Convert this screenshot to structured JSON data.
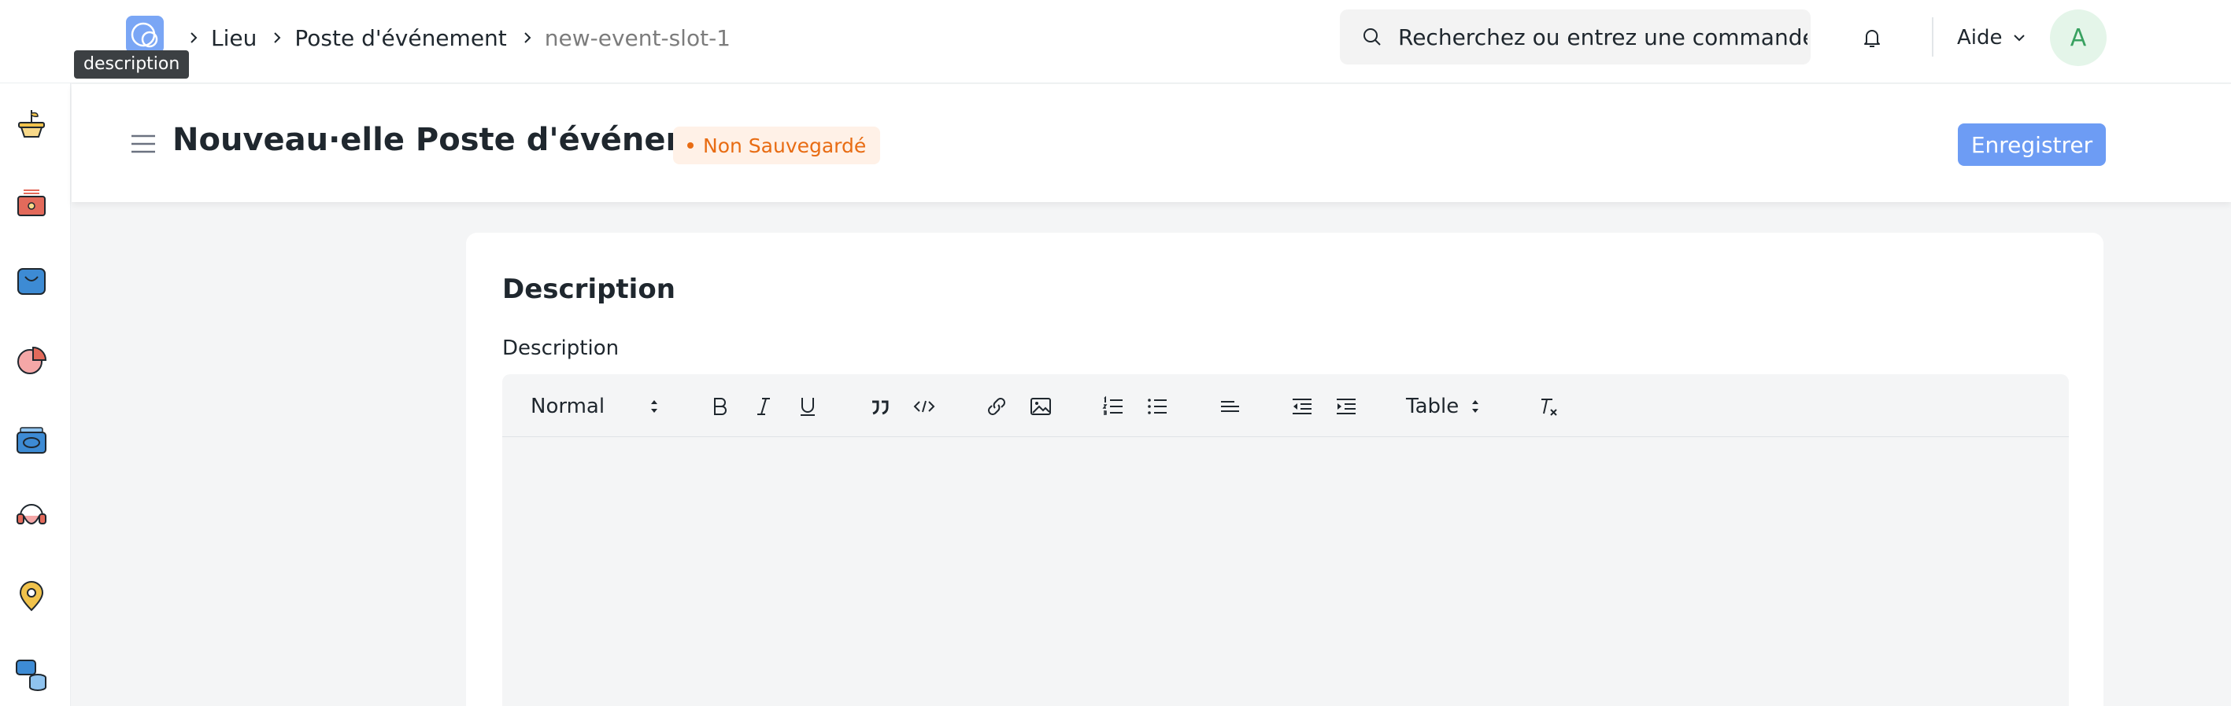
{
  "navbar": {
    "tooltip": "description",
    "breadcrumbs": [
      "Lieu",
      "Poste d'événement",
      "new-event-slot-1"
    ],
    "search_placeholder": "Recherchez ou entrez une commande",
    "help_label": "Aide",
    "avatar_initial": "A"
  },
  "sidebar": {
    "icons": [
      "plant-pot-icon",
      "cash-box-icon",
      "shopping-bag-icon",
      "pie-chart-icon",
      "card-stack-icon",
      "support-headset-icon",
      "map-pin-icon",
      "chat-database-icon"
    ]
  },
  "page_head": {
    "title": "Nouveau·elle Poste d'événement",
    "status": "Non Sauvegardé",
    "save_label": "Enregistrer"
  },
  "form": {
    "section_title": "Description",
    "field_label": "Description",
    "editor": {
      "heading_select": "Normal",
      "table_select": "Table",
      "tools": [
        "bold",
        "italic",
        "underline",
        "blockquote",
        "code-block",
        "link",
        "image",
        "ordered-list",
        "bullet-list",
        "align",
        "outdent",
        "indent",
        "table",
        "clear-format"
      ]
    }
  },
  "colors": {
    "primary": "#6d9cf4",
    "unsaved": "#e86c13",
    "unsaved_bg": "#fff1e7",
    "background": "#f4f5f6"
  }
}
